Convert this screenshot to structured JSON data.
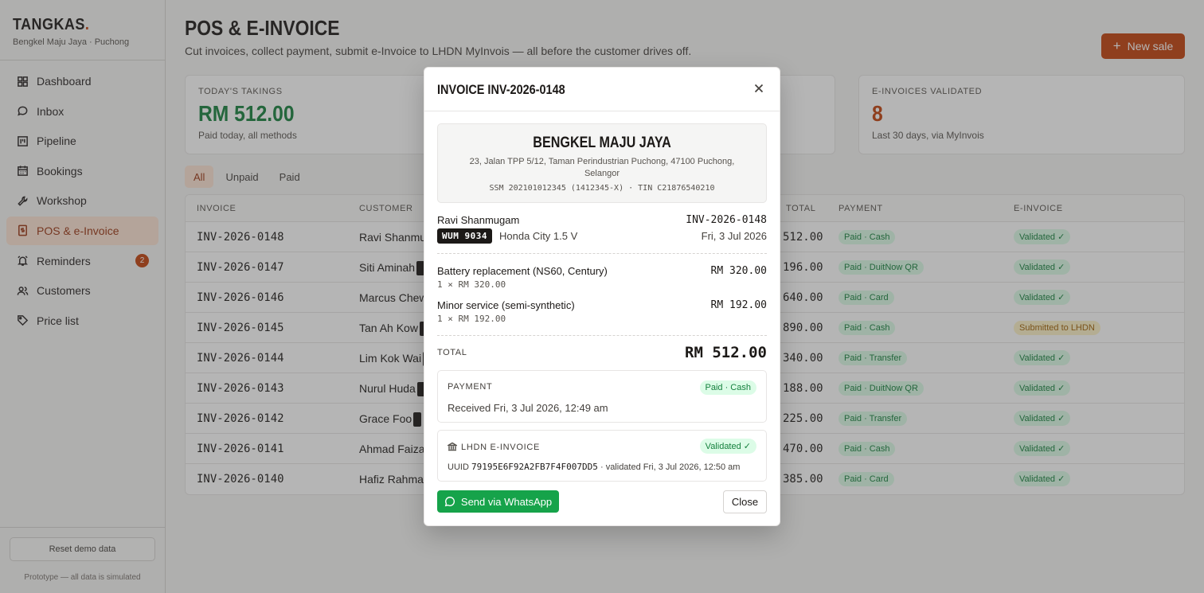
{
  "brand": {
    "name": "TANGKAS",
    "dot": ".",
    "subtitle": "Bengkel Maju Jaya · Puchong"
  },
  "nav": [
    {
      "label": "Dashboard",
      "icon": "dashboard-icon"
    },
    {
      "label": "Inbox",
      "icon": "chat-bubble-icon"
    },
    {
      "label": "Pipeline",
      "icon": "kanban-icon"
    },
    {
      "label": "Bookings",
      "icon": "calendar-icon"
    },
    {
      "label": "Workshop",
      "icon": "wrench-icon"
    },
    {
      "label": "POS & e-Invoice",
      "icon": "receipt-icon",
      "active": true
    },
    {
      "label": "Reminders",
      "icon": "alarm-icon",
      "badge": "2"
    },
    {
      "label": "Customers",
      "icon": "users-icon"
    },
    {
      "label": "Price list",
      "icon": "tag-icon"
    }
  ],
  "sidebar_footer": {
    "reset_label": "Reset demo data",
    "note": "Prototype — all data is simulated"
  },
  "page": {
    "title": "POS & E-INVOICE",
    "subtitle": "Cut invoices, collect payment, submit e-Invoice to LHDN MyInvois — all before the customer drives off.",
    "new_sale_label": "New sale"
  },
  "stats": [
    {
      "label": "TODAY'S TAKINGS",
      "value": "RM 512.00",
      "note": "Paid today, all methods",
      "color": "#15803d"
    },
    {
      "label": "E-INVOICES VALIDATED",
      "value": "8",
      "note": "Last 30 days, via MyInvois",
      "color": "#c2410c"
    }
  ],
  "filters": [
    "All",
    "Unpaid",
    "Paid"
  ],
  "table": {
    "headers": {
      "invoice": "INVOICE",
      "customer": "CUSTOMER",
      "total": "TOTAL",
      "payment": "PAYMENT",
      "einvoice": "E-INVOICE"
    },
    "rows": [
      {
        "invoice": "INV-2026-0148",
        "customer": "Ravi Shanmu",
        "total": "512.00",
        "payment": "Paid · Cash",
        "einvoice": "Validated ✓"
      },
      {
        "invoice": "INV-2026-0147",
        "customer": "Siti Aminah",
        "total": "196.00",
        "payment": "Paid · DuitNow QR",
        "einvoice": "Validated ✓"
      },
      {
        "invoice": "INV-2026-0146",
        "customer": "Marcus Chew",
        "total": "640.00",
        "payment": "Paid · Card",
        "einvoice": "Validated ✓"
      },
      {
        "invoice": "INV-2026-0145",
        "customer": "Tan Ah Kow",
        "total": "890.00",
        "payment": "Paid · Cash",
        "einvoice": "Submitted to LHDN"
      },
      {
        "invoice": "INV-2026-0144",
        "customer": "Lim Kok Wai",
        "total": "340.00",
        "payment": "Paid · Transfer",
        "einvoice": "Validated ✓"
      },
      {
        "invoice": "INV-2026-0143",
        "customer": "Nurul Huda",
        "total": "188.00",
        "payment": "Paid · DuitNow QR",
        "einvoice": "Validated ✓"
      },
      {
        "invoice": "INV-2026-0142",
        "customer": "Grace Foo",
        "total": "225.00",
        "payment": "Paid · Transfer",
        "einvoice": "Validated ✓"
      },
      {
        "invoice": "INV-2026-0141",
        "customer": "Ahmad Faizal",
        "total": "470.00",
        "payment": "Paid · Cash",
        "einvoice": "Validated ✓"
      },
      {
        "invoice": "INV-2026-0140",
        "customer": "Hafiz Rahman",
        "total": "385.00",
        "payment": "Paid · Card",
        "einvoice": "Validated ✓"
      }
    ]
  },
  "modal": {
    "title": "INVOICE INV-2026-0148",
    "business": {
      "name": "BENGKEL MAJU JAYA",
      "address": "23, Jalan TPP 5/12, Taman Perindustrian Puchong, 47100 Puchong, Selangor",
      "ids": "SSM 202101012345 (1412345-X) · TIN C21876540210"
    },
    "customer": "Ravi Shanmugam",
    "invoice_no": "INV-2026-0148",
    "plate": "WUM 9034",
    "vehicle": "Honda City 1.5 V",
    "date": "Fri, 3 Jul 2026",
    "lines": [
      {
        "desc": "Battery replacement (NS60, Century)",
        "qty": "1 × RM 320.00",
        "amount": "RM 320.00"
      },
      {
        "desc": "Minor service (semi-synthetic)",
        "qty": "1 × RM 192.00",
        "amount": "RM 192.00"
      }
    ],
    "total_label": "TOTAL",
    "total": "RM 512.00",
    "payment": {
      "label": "PAYMENT",
      "status": "Paid · Cash",
      "received": "Received Fri, 3 Jul 2026, 12:49 am"
    },
    "einvoice": {
      "label": "LHDN E-INVOICE",
      "status": "Validated ✓",
      "uuid_prefix": "UUID",
      "uuid": "79195E6F92A2FB7F4F007DD5",
      "validated": "· validated Fri, 3 Jul 2026, 12:50 am"
    },
    "whatsapp_label": "Send via WhatsApp",
    "close_label": "Close"
  }
}
